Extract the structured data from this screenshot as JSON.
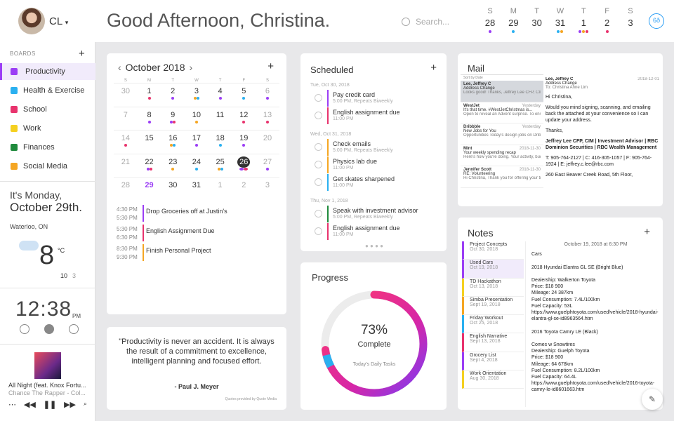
{
  "header": {
    "initials": "CL",
    "greeting": "Good Afternoon, Christina.",
    "search_placeholder": "Search...",
    "week": [
      {
        "d": "S",
        "n": "28",
        "dots": [
          "#9b3ef5"
        ]
      },
      {
        "d": "M",
        "n": "29",
        "dots": [
          "#2ab0f0"
        ]
      },
      {
        "d": "T",
        "n": "30",
        "dots": []
      },
      {
        "d": "W",
        "n": "31",
        "dots": [
          "#2ab0f0",
          "#f5a623"
        ]
      },
      {
        "d": "T",
        "n": "1",
        "dots": [
          "#9b3ef5",
          "#f5a623",
          "#e8336d"
        ]
      },
      {
        "d": "F",
        "n": "2",
        "dots": [
          "#e8336d"
        ]
      },
      {
        "d": "S",
        "n": "3",
        "dots": []
      }
    ],
    "logo_icon": "infinity-logo-icon",
    "logo_text": "6ð"
  },
  "sidebar": {
    "boards_heading": "BOARDS",
    "add": "+",
    "boards": [
      {
        "label": "Productivity",
        "color": "#9b3ef5"
      },
      {
        "label": "Health & Exercise",
        "color": "#2ab0f0"
      },
      {
        "label": "School",
        "color": "#e8336d"
      },
      {
        "label": "Work",
        "color": "#f5d020"
      },
      {
        "label": "Finances",
        "color": "#1f8a3c"
      },
      {
        "label": "Social Media",
        "color": "#f5a623"
      }
    ],
    "weather": {
      "weekday": "It's Monday,",
      "date": "October 29th.",
      "city": "Waterloo, ON",
      "temp": "8",
      "unit": "°C",
      "high": "10",
      "low": "3"
    },
    "clock": {
      "time": "12:38",
      "ampm": "PM"
    },
    "music": {
      "song": "All Night (feat. Knox Fortu...",
      "artist": "Chance The Rapper - Col..."
    }
  },
  "calendar": {
    "month": "October 2018",
    "prev": "‹",
    "next": "›",
    "add": "+",
    "dow": [
      "S",
      "M",
      "T",
      "W",
      "T",
      "F",
      "S"
    ],
    "weeks": [
      [
        {
          "n": "30",
          "m": 1
        },
        {
          "n": "1",
          "dots": [
            "#e8336d"
          ]
        },
        {
          "n": "2",
          "dots": [
            "#9b3ef5"
          ]
        },
        {
          "n": "3",
          "dots": [
            "#f5a623",
            "#2ab0f0"
          ]
        },
        {
          "n": "4",
          "dots": [
            "#9b3ef5"
          ]
        },
        {
          "n": "5",
          "dots": [
            "#2ab0f0"
          ]
        },
        {
          "n": "6",
          "m": 1,
          "dots": [
            "#9b3ef5"
          ]
        }
      ],
      [
        {
          "n": "7",
          "m": 1
        },
        {
          "n": "8",
          "dots": [
            "#9b3ef5"
          ]
        },
        {
          "n": "9",
          "dots": [
            "#9b3ef5",
            "#e8336d"
          ]
        },
        {
          "n": "10",
          "dots": [
            "#f5a623"
          ]
        },
        {
          "n": "11"
        },
        {
          "n": "12",
          "dots": [
            "#e8336d"
          ]
        },
        {
          "n": "13",
          "m": 1,
          "dots": [
            "#e8336d"
          ]
        }
      ],
      [
        {
          "n": "14",
          "m": 1,
          "dots": [
            "#e8336d"
          ]
        },
        {
          "n": "15"
        },
        {
          "n": "16",
          "dots": [
            "#f5a623",
            "#2ab0f0"
          ]
        },
        {
          "n": "17",
          "dots": [
            "#9b3ef5"
          ]
        },
        {
          "n": "18",
          "dots": [
            "#2ab0f0"
          ]
        },
        {
          "n": "19",
          "dots": [
            "#9b3ef5"
          ]
        },
        {
          "n": "20",
          "m": 1
        }
      ],
      [
        {
          "n": "21",
          "m": 1
        },
        {
          "n": "22",
          "dots": [
            "#9b3ef5",
            "#e8336d"
          ]
        },
        {
          "n": "23",
          "dots": [
            "#f5a623"
          ]
        },
        {
          "n": "24",
          "dots": [
            "#2ab0f0"
          ]
        },
        {
          "n": "25",
          "dots": [
            "#f5a623",
            "#2ab0f0"
          ]
        },
        {
          "n": "26",
          "today": 1,
          "dots": [
            "#9b3ef5",
            "#e8336d"
          ]
        },
        {
          "n": "27",
          "m": 1,
          "dots": [
            "#9b3ef5"
          ]
        }
      ],
      [
        {
          "n": "28",
          "m": 1
        },
        {
          "n": "29",
          "sel": 1
        },
        {
          "n": "30"
        },
        {
          "n": "31"
        },
        {
          "n": "1",
          "m": 1
        },
        {
          "n": "2",
          "m": 1
        },
        {
          "n": "3",
          "m": 1
        }
      ]
    ],
    "events": [
      {
        "start": "4:30 PM",
        "end": "5:30 PM",
        "title": "Drop Groceries off at Justin's",
        "color": "#9b3ef5"
      },
      {
        "start": "5:30 PM",
        "end": "6:30 PM",
        "title": "English Assignment Due",
        "color": "#e8336d"
      },
      {
        "start": "8:30 PM",
        "end": "9:30 PM",
        "title": "Finish Personal Project",
        "color": "#f5a623"
      }
    ]
  },
  "quote": {
    "text": "\"Productivity is never an accident. It is always the result of a commitment to excellence, intelligent planning and focused effort.",
    "author": "- Paul J. Meyer",
    "source": "Quotes provided by Quote Media"
  },
  "scheduled": {
    "title": "Scheduled",
    "add": "+",
    "groups": [
      {
        "date": "Tue, Oct 30, 2018",
        "tasks": [
          {
            "title": "Pay credit card",
            "sub": "5:00 PM, Repeats Biweekly",
            "color": "#9b3ef5"
          },
          {
            "title": "English assignment due",
            "sub": "11:00 PM",
            "color": "#e8336d"
          }
        ]
      },
      {
        "date": "Wed, Oct 31, 2018",
        "tasks": [
          {
            "title": "Check emails",
            "sub": "5:00 PM, Repeats Biweekly",
            "color": "#f5a623"
          },
          {
            "title": "Physics lab due",
            "sub": "11:00 PM",
            "color": "#f5a623"
          },
          {
            "title": "Get skates sharpened",
            "sub": "11:00 PM",
            "color": "#2ab0f0"
          }
        ]
      },
      {
        "date": "Thu, Nov 1, 2018",
        "tasks": [
          {
            "title": "Speak with investment advisor",
            "sub": "5:00 PM, Repeats Biweekly",
            "color": "#1f8a3c"
          },
          {
            "title": "English assignment due",
            "sub": "11:00 PM",
            "color": "#e8336d"
          }
        ]
      }
    ],
    "pager": "● ● ● ●"
  },
  "progress": {
    "title": "Progress",
    "percent": 73,
    "percent_label": "73%",
    "label": "Complete",
    "sub": "Today's Daily Tasks"
  },
  "mail": {
    "title": "Mail",
    "sort": "Sort by Date",
    "items": [
      {
        "from": "Lee, Jeffrey C",
        "date": "",
        "subject": "Address Change",
        "preview": "Looks good! Thanks, Jeffrey Lee CFP, CIM | Investment Advisor | RBC Domi..."
      },
      {
        "from": "WestJet",
        "date": "Yesterday",
        "subject": "It's that time. #WestJetChristmas is...",
        "preview": "Open to reveal an Advent surprise. To ensure you receive emails from Westj..."
      },
      {
        "from": "Dribbble",
        "date": "Yesterday",
        "subject": "New Jobs for You",
        "preview": "Opportunities Today's design jobs on Dribbble December 2018 Le..."
      },
      {
        "from": "Mint",
        "date": "2018-11-30",
        "subject": "Your weekly spending recap",
        "preview": "Here's how you're doing. Your activity, budgets, and personalized tips..."
      },
      {
        "from": "Jennifer Scott",
        "date": "2018-11-30",
        "subject": "RE: Volunteering",
        "preview": "Hi Christina, Thank you for offering your time to the Christmas hamper p..."
      }
    ],
    "view": {
      "from": "Lee, Jeffrey C",
      "date": "2018-12-01",
      "avatar": "JL",
      "subject": "Address Change",
      "to": "To: Christina Anne Lim",
      "body": [
        "Hi Christina,",
        "Would you mind signing, scanning, and emailing back the attached at your convenience so I can update your address.",
        "Thanks,",
        "Jeffrey Lee CFP, CIM | Investment Advisor | RBC Dominion Securities | RBC Wealth Management",
        "T: 905-764-2127 | C: 416-305-1057 | F: 905-764-1924 | E: jeffrey.c.lee@rbc.com",
        "260 East Beaver Creek Road, 5th Floor,"
      ]
    }
  },
  "notes": {
    "title": "Notes",
    "add": "+",
    "list": [
      {
        "t": "Project Concepts",
        "d": "Oct 30, 2018",
        "color": "#9b3ef5"
      },
      {
        "t": "Used Cars",
        "d": "Oct 19, 2018",
        "color": "#9b3ef5"
      },
      {
        "t": "TD Hackathon",
        "d": "Oct 13, 2018",
        "color": "#f5d020"
      },
      {
        "t": "Simba Presentation",
        "d": "Sept 19, 2018",
        "color": "#f5a623"
      },
      {
        "t": "Friday Workout",
        "d": "Oct 25, 2018",
        "color": "#2ab0f0"
      },
      {
        "t": "English Narrative",
        "d": "Sept 13, 2018",
        "color": "#e8336d"
      },
      {
        "t": "Grocery List",
        "d": "Sept 4, 2018",
        "color": "#9b3ef5"
      },
      {
        "t": "Work Orientation",
        "d": "Aug 30, 2018",
        "color": "#f5d020"
      }
    ],
    "body_date": "October 19, 2018 at 6:30 PM",
    "body": [
      "Cars",
      "",
      "2018 Hyundai Elantra GL SE (Bright Blue)",
      "",
      "Dealership: Walkerton Toyota",
      "Price: $18 900",
      "Mileage: 24 387km",
      "Fuel Consumption: 7.4L/100km",
      "Fuel Capacity: 53L",
      "https://www.guelphtoyota.com/used/vehicle/2018-hyundai-elantra-gl-se-id8963564.htm",
      "",
      "2016 Toyota Camry LE (Black)",
      "",
      "Comes w Snowtires",
      "Dealership: Guelph Toyota",
      "Price: $18 900",
      "Mileage: 64 678km",
      "Fuel Consumption: 8.2L/100km",
      "Fuel Capacity: 64.4L",
      "https://www.guelphtoyota.com/used/vehicle/2016-toyota-camry-le-id8601663.htm"
    ]
  }
}
